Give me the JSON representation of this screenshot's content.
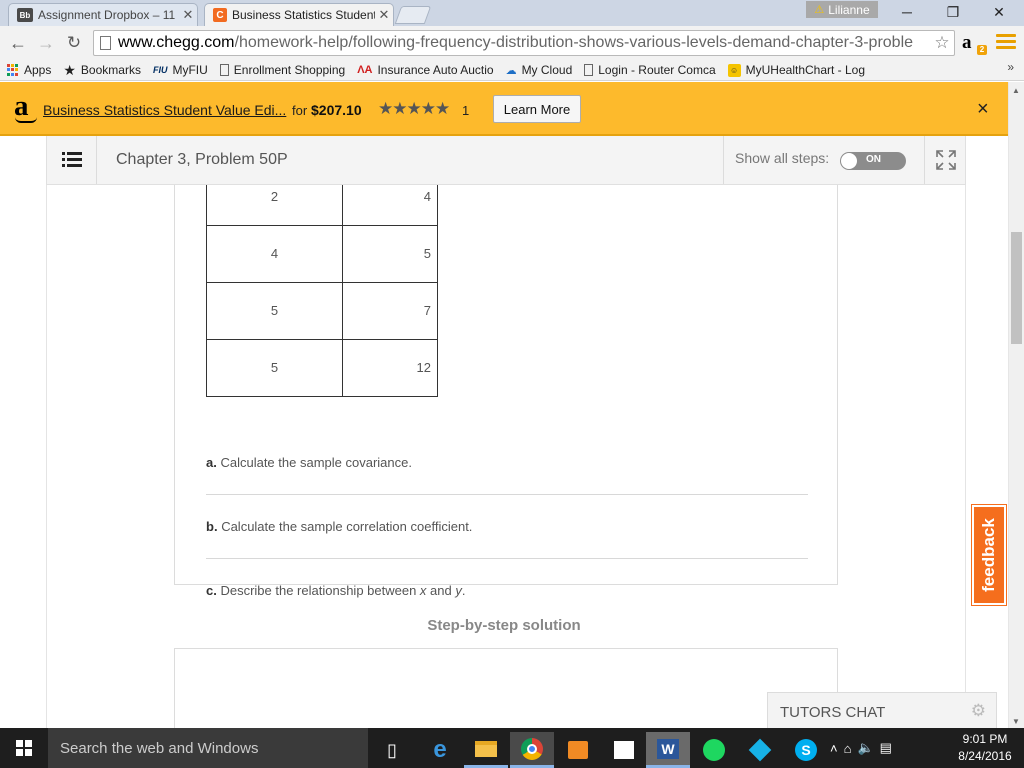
{
  "browser": {
    "tabs": [
      {
        "label": "Assignment Dropbox – 11",
        "favicon": "blackboard-icon",
        "active": false
      },
      {
        "label": "Business Statistics Student",
        "favicon": "chegg-icon",
        "active": true
      }
    ],
    "profile_name": "Lilianne",
    "url_host": "www.chegg.com",
    "url_path": "/homework-help/following-frequency-distribution-shows-various-levels-demand-chapter-3-proble",
    "bookmarks": [
      {
        "label": "Apps",
        "icon": "apps-grid-icon"
      },
      {
        "label": "Bookmarks",
        "icon": "star-icon"
      },
      {
        "label": "MyFIU",
        "icon": "fiu-icon"
      },
      {
        "label": "Enrollment Shopping",
        "icon": "page-icon"
      },
      {
        "label": "Insurance Auto Auctio",
        "icon": "iaa-icon"
      },
      {
        "label": "My Cloud",
        "icon": "cloud-icon"
      },
      {
        "label": "Login - Router Comca",
        "icon": "page-icon"
      },
      {
        "label": "MyUHealthChart - Log",
        "icon": "myuhealth-icon"
      }
    ]
  },
  "amazon_banner": {
    "product": "Business Statistics Student Value Edi...",
    "for_text": "for",
    "price": "$207.10",
    "stars": "★★★★★",
    "rating_value": 5,
    "review_count": "1",
    "learn_more": "Learn More",
    "close": "×"
  },
  "chegg": {
    "chapter_title": "Chapter 3, Problem 50P",
    "show_all_steps_label": "Show all steps:",
    "toggle_label": "ON",
    "table_rows": [
      {
        "x": "2",
        "y": "4"
      },
      {
        "x": "4",
        "y": "5"
      },
      {
        "x": "5",
        "y": "7"
      },
      {
        "x": "5",
        "y": "12"
      }
    ],
    "questions": [
      {
        "letter": "a.",
        "text": "Calculate the sample covariance."
      },
      {
        "letter": "b.",
        "text": "Calculate the sample correlation coefficient."
      },
      {
        "letter": "c.",
        "text_before": "Describe the relationship between ",
        "x_var": "x",
        "and": " and ",
        "y_var": "y",
        "end": "."
      }
    ],
    "solution_heading": "Step-by-step solution",
    "feedback_label": "feedback",
    "tutors_chat_label": "TUTORS CHAT"
  },
  "taskbar": {
    "search_placeholder": "Search the web and Windows",
    "time": "9:01 PM",
    "date": "8/24/2016"
  },
  "colors": {
    "amazon_banner": "#fdba2c",
    "chegg_orange": "#f56e1d",
    "taskbar": "#1e1e1e"
  }
}
